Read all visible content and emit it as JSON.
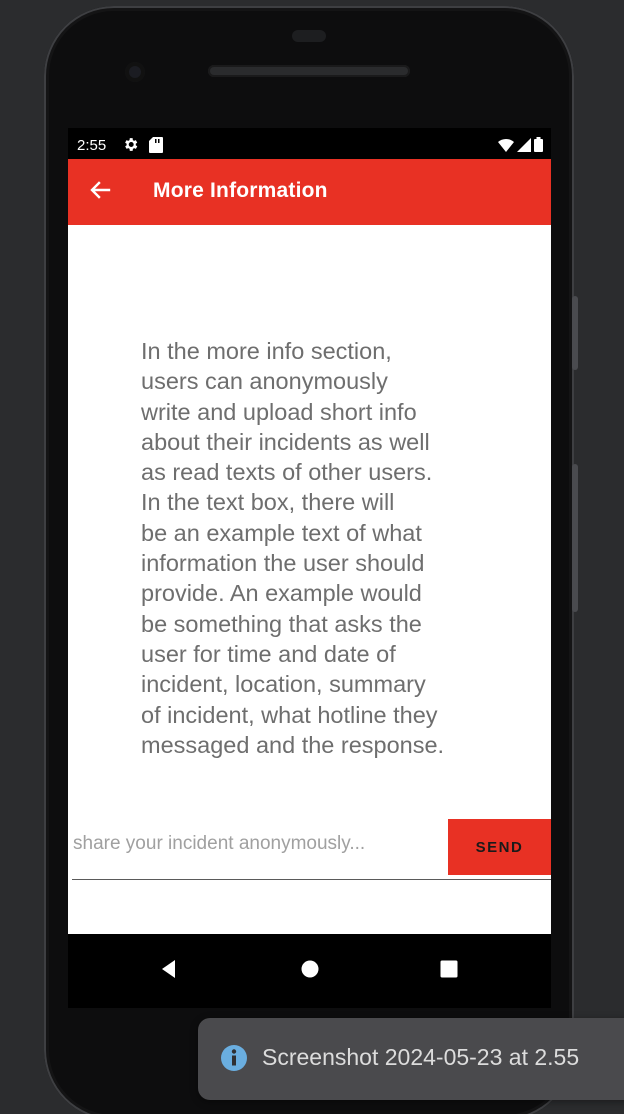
{
  "status_bar": {
    "time": "2:55"
  },
  "app_bar": {
    "title": "More Information"
  },
  "content": {
    "info_text": "In the more info section,\nusers can anonymously\nwrite and upload short info\nabout their incidents as well\nas read texts of other users.\nIn the text box, there will\nbe an example text of what\ninformation the user should\nprovide. An example would\nbe something that asks the\nuser for time and date of\nincident, location, summary\nof incident, what hotline they\nmessaged and the response."
  },
  "composer": {
    "input_value": "",
    "input_placeholder": "share your incident anonymously...",
    "send_label": "SEND"
  },
  "toast": {
    "text": "Screenshot 2024-05-23 at 2.55"
  },
  "colors": {
    "accent": "#e83124",
    "text_muted": "#6e6e6e",
    "toast_bg": "#4a4a4d",
    "toast_icon": "#6aaee0"
  },
  "icons": {
    "status_left": [
      "gear-icon",
      "sd-card-icon"
    ],
    "status_right": [
      "wifi-icon",
      "signal-icon",
      "battery-icon"
    ],
    "app_bar": "back-arrow-icon",
    "nav": [
      "nav-back-icon",
      "nav-home-icon",
      "nav-recents-icon"
    ],
    "toast": "info-icon"
  }
}
